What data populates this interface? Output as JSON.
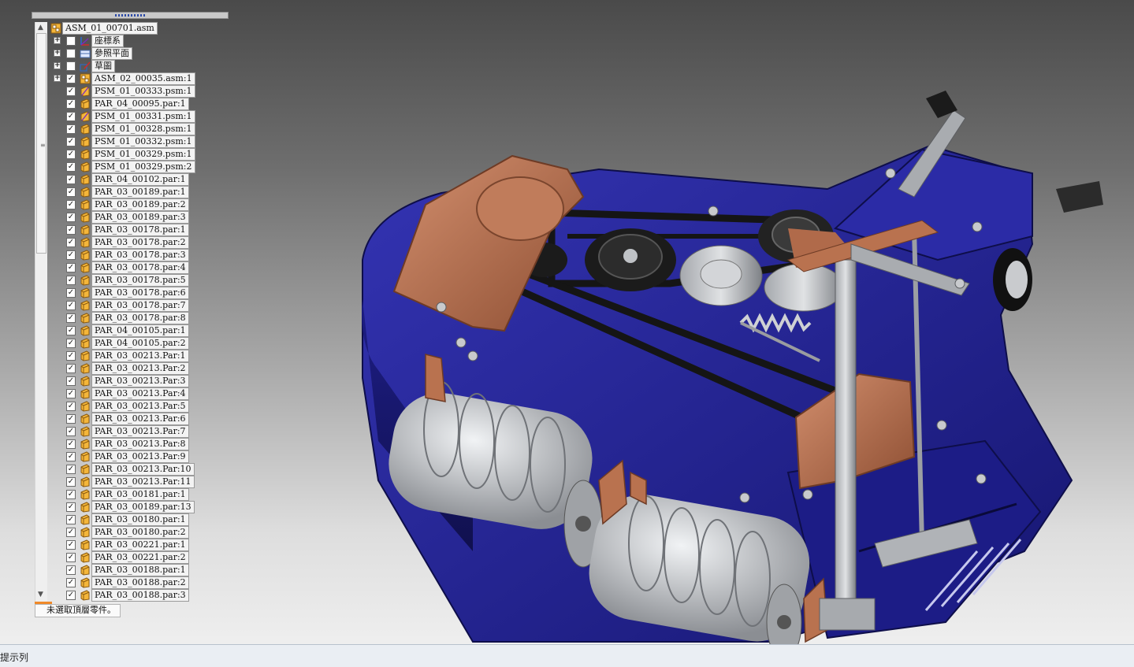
{
  "tree": {
    "root": {
      "label": "ASM_01_00701.asm",
      "icon": "assembly-icon"
    },
    "items": [
      {
        "label": "座標系",
        "icon": "coordinate-system-icon",
        "expandable": true,
        "checked": false
      },
      {
        "label": "參照平面",
        "icon": "reference-plane-icon",
        "expandable": true,
        "checked": false
      },
      {
        "label": "草圖",
        "icon": "sketch-icon",
        "expandable": true,
        "checked": false
      },
      {
        "label": "ASM_02_00035.asm:1",
        "icon": "assembly-icon",
        "expandable": true,
        "checked": true
      },
      {
        "label": "PSM_01_00333.psm:1",
        "icon": "sheetmetal-part-icon",
        "checked": true
      },
      {
        "label": "PAR_04_00095.par:1",
        "icon": "part-icon",
        "checked": true
      },
      {
        "label": "PSM_01_00331.psm:1",
        "icon": "sheetmetal-part-icon",
        "checked": true
      },
      {
        "label": "PSM_01_00328.psm:1",
        "icon": "part-icon",
        "checked": true
      },
      {
        "label": "PSM_01_00332.psm:1",
        "icon": "part-icon",
        "checked": true
      },
      {
        "label": "PSM_01_00329.psm:1",
        "icon": "part-icon",
        "checked": true
      },
      {
        "label": "PSM_01_00329.psm:2",
        "icon": "part-icon",
        "checked": true
      },
      {
        "label": "PAR_04_00102.par:1",
        "icon": "part-icon",
        "checked": true
      },
      {
        "label": "PAR_03_00189.par:1",
        "icon": "part-icon",
        "checked": true
      },
      {
        "label": "PAR_03_00189.par:2",
        "icon": "part-icon",
        "checked": true
      },
      {
        "label": "PAR_03_00189.par:3",
        "icon": "part-icon",
        "checked": true
      },
      {
        "label": "PAR_03_00178.par:1",
        "icon": "part-icon",
        "checked": true
      },
      {
        "label": "PAR_03_00178.par:2",
        "icon": "part-icon",
        "checked": true
      },
      {
        "label": "PAR_03_00178.par:3",
        "icon": "part-icon",
        "checked": true
      },
      {
        "label": "PAR_03_00178.par:4",
        "icon": "part-icon",
        "checked": true
      },
      {
        "label": "PAR_03_00178.par:5",
        "icon": "part-icon",
        "checked": true
      },
      {
        "label": "PAR_03_00178.par:6",
        "icon": "part-icon",
        "checked": true
      },
      {
        "label": "PAR_03_00178.par:7",
        "icon": "part-icon",
        "checked": true
      },
      {
        "label": "PAR_03_00178.par:8",
        "icon": "part-icon",
        "checked": true
      },
      {
        "label": "PAR_04_00105.par:1",
        "icon": "part-icon",
        "checked": true
      },
      {
        "label": "PAR_04_00105.par:2",
        "icon": "part-icon",
        "checked": true
      },
      {
        "label": "PAR_03_00213.Par:1",
        "icon": "part-icon",
        "checked": true
      },
      {
        "label": "PAR_03_00213.Par:2",
        "icon": "part-icon",
        "checked": true
      },
      {
        "label": "PAR_03_00213.Par:3",
        "icon": "part-icon",
        "checked": true
      },
      {
        "label": "PAR_03_00213.Par:4",
        "icon": "part-icon",
        "checked": true
      },
      {
        "label": "PAR_03_00213.Par:5",
        "icon": "part-icon",
        "checked": true
      },
      {
        "label": "PAR_03_00213.Par:6",
        "icon": "part-icon",
        "checked": true
      },
      {
        "label": "PAR_03_00213.Par:7",
        "icon": "part-icon",
        "checked": true
      },
      {
        "label": "PAR_03_00213.Par:8",
        "icon": "part-icon",
        "checked": true
      },
      {
        "label": "PAR_03_00213.Par:9",
        "icon": "part-icon",
        "checked": true
      },
      {
        "label": "PAR_03_00213.Par:10",
        "icon": "part-icon",
        "checked": true
      },
      {
        "label": "PAR_03_00213.Par:11",
        "icon": "part-icon",
        "checked": true
      },
      {
        "label": "PAR_03_00181.par:1",
        "icon": "part-icon",
        "checked": true
      },
      {
        "label": "PAR_03_00189.par:13",
        "icon": "part-icon",
        "checked": true
      },
      {
        "label": "PAR_03_00180.par:1",
        "icon": "part-icon",
        "checked": true
      },
      {
        "label": "PAR_03_00180.par:2",
        "icon": "part-icon",
        "checked": true
      },
      {
        "label": "PAR_03_00221.par:1",
        "icon": "part-icon",
        "checked": true
      },
      {
        "label": "PAR_03_00221.par:2",
        "icon": "part-icon",
        "checked": true
      },
      {
        "label": "PAR_03_00188.par:1",
        "icon": "part-icon",
        "checked": true
      },
      {
        "label": "PAR_03_00188.par:2",
        "icon": "part-icon",
        "checked": true
      },
      {
        "label": "PAR_03_00188.par:3",
        "icon": "part-icon",
        "checked": true
      }
    ]
  },
  "selection_message": "未選取頂層零件。",
  "statusbar": {
    "prompt": "提示列"
  },
  "colors": {
    "deck_blue": "#24239a",
    "copper": "#b66e50",
    "roller": "#c4c6ca",
    "belt": "#151515"
  }
}
